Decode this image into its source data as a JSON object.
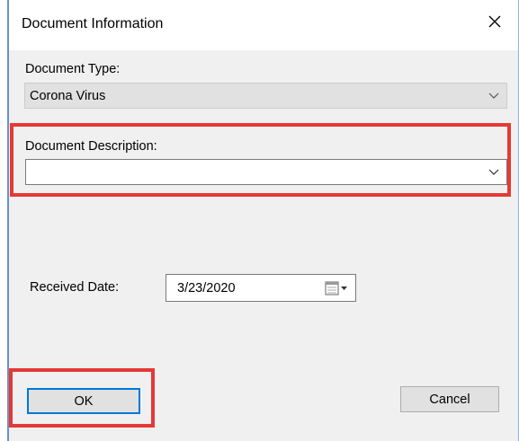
{
  "window": {
    "title": "Document Information"
  },
  "document_type": {
    "label": "Document Type:",
    "value": "Corona Virus"
  },
  "document_description": {
    "label": "Document Description:",
    "value": ""
  },
  "received_date": {
    "label": "Received Date:",
    "value": "3/23/2020"
  },
  "buttons": {
    "ok": "OK",
    "cancel": "Cancel"
  },
  "colors": {
    "highlight": "#e53935",
    "dialog_bg": "#f0f0f0",
    "focus_border": "#0078d7"
  },
  "icons": {
    "close": "close-icon",
    "dropdown": "chevron-down-icon",
    "calendar": "calendar-icon"
  }
}
